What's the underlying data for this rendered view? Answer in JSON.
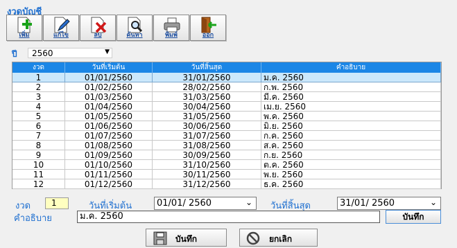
{
  "window": {
    "title": "งวดบัญชี"
  },
  "toolbar": {
    "buttons": [
      {
        "label": "เพิ่ม",
        "icon": "add-document-icon"
      },
      {
        "label": "แก้ไข",
        "icon": "edit-document-icon"
      },
      {
        "label": "ลบ",
        "icon": "delete-document-icon"
      },
      {
        "label": "ค้นหา",
        "icon": "search-document-icon"
      },
      {
        "label": "พิมพ์",
        "icon": "printer-icon"
      },
      {
        "label": "ออก",
        "icon": "exit-door-icon"
      }
    ]
  },
  "year_filter": {
    "label": "ปี",
    "value": "2560"
  },
  "table": {
    "columns": [
      "งวด",
      "วันที่เริ่มต้น",
      "วันที่สิ้นสุด",
      "คำอธิบาย"
    ],
    "selected_row": 0,
    "rows": [
      [
        "1",
        "01/01/2560",
        "31/01/2560",
        "ม.ค. 2560"
      ],
      [
        "2",
        "01/02/2560",
        "28/02/2560",
        "ก.พ. 2560"
      ],
      [
        "3",
        "01/03/2560",
        "31/03/2560",
        "มี.ค. 2560"
      ],
      [
        "4",
        "01/04/2560",
        "30/04/2560",
        "เม.ย. 2560"
      ],
      [
        "5",
        "01/05/2560",
        "31/05/2560",
        "พ.ค. 2560"
      ],
      [
        "6",
        "01/06/2560",
        "30/06/2560",
        "มิ.ย. 2560"
      ],
      [
        "7",
        "01/07/2560",
        "31/07/2560",
        "ก.ค. 2560"
      ],
      [
        "8",
        "01/08/2560",
        "31/08/2560",
        "ส.ค. 2560"
      ],
      [
        "9",
        "01/09/2560",
        "30/09/2560",
        "ก.ย. 2560"
      ],
      [
        "10",
        "01/10/2560",
        "31/10/2560",
        "ต.ค. 2560"
      ],
      [
        "11",
        "01/11/2560",
        "30/11/2560",
        "พ.ย. 2560"
      ],
      [
        "12",
        "01/12/2560",
        "31/12/2560",
        "ธ.ค. 2560"
      ]
    ]
  },
  "form": {
    "period_label": "งวด",
    "period_value": "1",
    "start_label": "วันที่เริ่มต้น",
    "start_value": "01/01/  2560",
    "end_label": "วันที่สิ้นสุด",
    "end_value": "31/01/  2560",
    "description_label": "คำอธิบาย",
    "description_value": "ม.ค. 2560",
    "save_small_label": "บันทึก"
  },
  "footer": {
    "save_label": "บันทึก",
    "cancel_label": "ยกเลิก"
  },
  "colors": {
    "accent": "#1e6fd0",
    "header": "#1b86e6",
    "selected_row": "#cbe8fb",
    "period_field": "#ffffc0"
  }
}
